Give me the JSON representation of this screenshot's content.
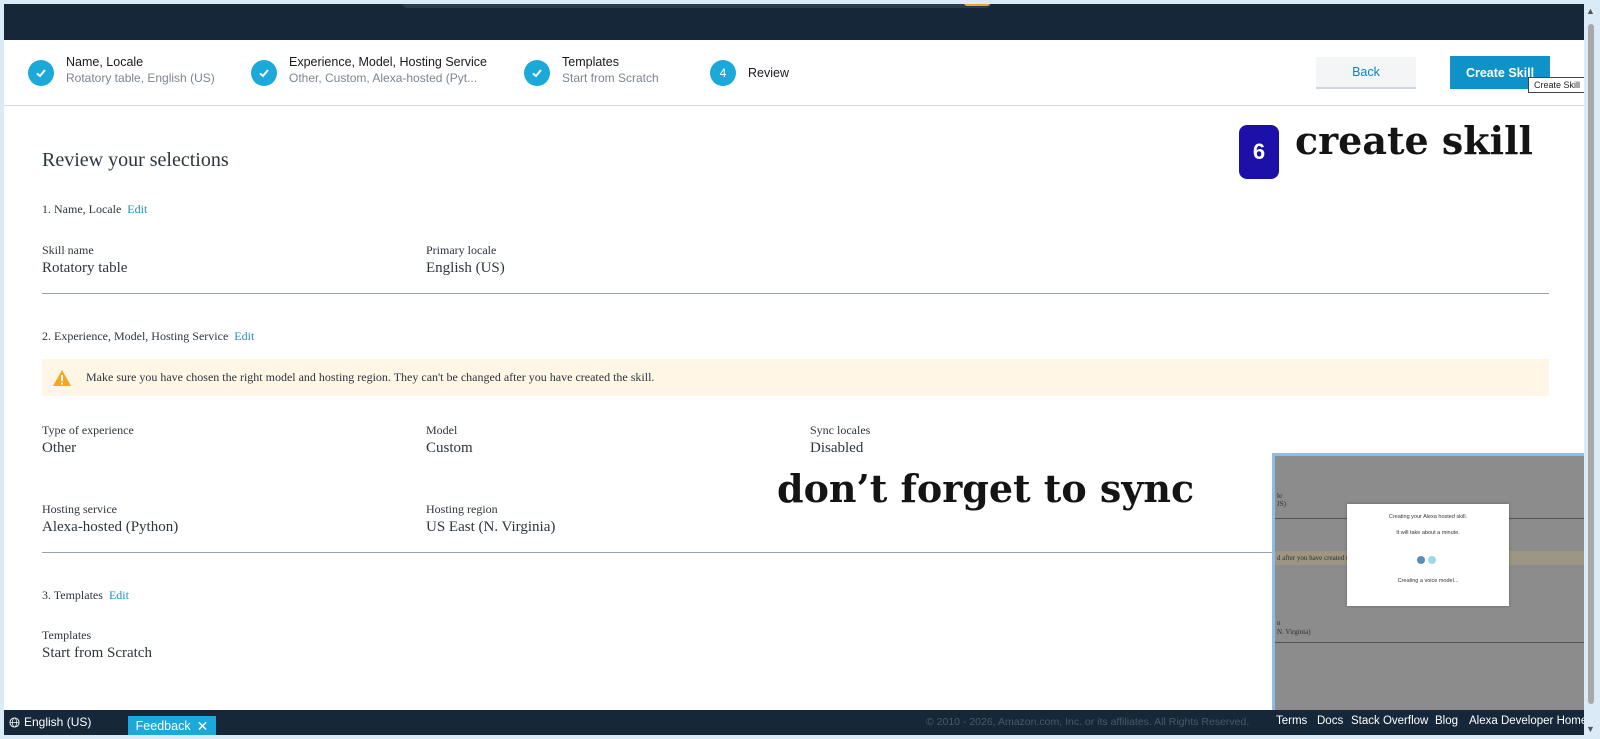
{
  "stepper": {
    "steps": [
      {
        "title": "Name, Locale",
        "subtitle": "Rotatory table, English (US)",
        "state": "done"
      },
      {
        "title": "Experience, Model, Hosting Service",
        "subtitle": "Other, Custom, Alexa-hosted (Pyt...",
        "state": "done"
      },
      {
        "title": "Templates",
        "subtitle": "Start from Scratch",
        "state": "done"
      },
      {
        "number": "4",
        "title": "Review",
        "state": "current"
      }
    ],
    "back_label": "Back",
    "create_label": "Create Skill",
    "tooltip": "Create Skill"
  },
  "review": {
    "title": "Review your selections",
    "edit_label": "Edit",
    "section1": {
      "heading": "1. Name, Locale",
      "skill_name_label": "Skill name",
      "skill_name_value": "Rotatory table",
      "primary_locale_label": "Primary locale",
      "primary_locale_value": "English (US)"
    },
    "section2": {
      "heading": "2. Experience, Model, Hosting Service",
      "warning": "Make sure you have chosen the right model and hosting region. They can't be changed after you have created the skill.",
      "type_label": "Type of experience",
      "type_value": "Other",
      "model_label": "Model",
      "model_value": "Custom",
      "sync_label": "Sync locales",
      "sync_value": "Disabled",
      "hosting_service_label": "Hosting service",
      "hosting_service_value": "Alexa-hosted (Python)",
      "hosting_region_label": "Hosting region",
      "hosting_region_value": "US East (N. Virginia)"
    },
    "section3": {
      "heading": "3. Templates",
      "templates_label": "Templates",
      "templates_value": "Start from Scratch"
    }
  },
  "annotations": {
    "badge_number": "6",
    "create_text": "create skill",
    "sync_text": "don’t forget to sync"
  },
  "inset": {
    "bg_snippets": [
      "le",
      "JS)",
      "d after you have created the sk",
      "n",
      "N. Virginia)"
    ],
    "modal_title": "Creating your Alexa hosted skill.",
    "modal_subtitle": "It will take about a minute.",
    "modal_status": "Creating a voice model..."
  },
  "footer": {
    "language": "English (US)",
    "feedback_label": "Feedback",
    "copyright": "© 2010 - 2026, Amazon.com, Inc. or its affiliates. All Rights Reserved.",
    "links": [
      "Terms",
      "Docs",
      "Stack Overflow",
      "Blog",
      "Alexa Developer Home"
    ]
  },
  "colors": {
    "accent": "#1ba9d9",
    "primary_button": "#0f92c8",
    "header_bg": "#16273a",
    "warning_bg": "#fff6e5",
    "badge": "#1d10a8"
  }
}
